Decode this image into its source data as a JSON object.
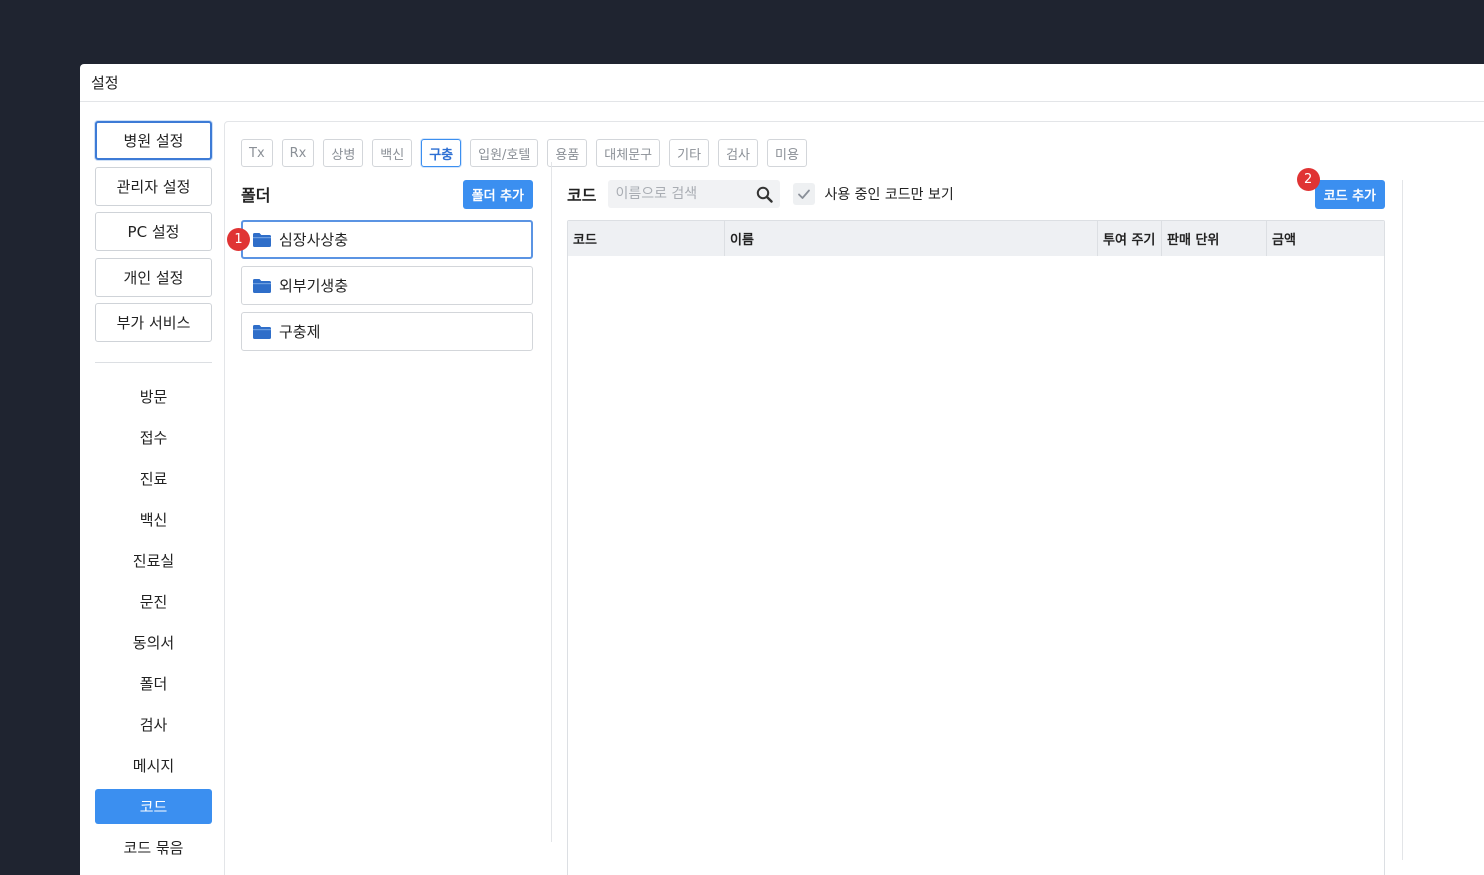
{
  "window": {
    "title": "설정"
  },
  "nav": {
    "buttons": [
      {
        "label": "병원 설정",
        "active": true
      },
      {
        "label": "관리자 설정",
        "active": false
      },
      {
        "label": "PC 설정",
        "active": false
      },
      {
        "label": "개인 설정",
        "active": false
      },
      {
        "label": "부가 서비스",
        "active": false
      }
    ],
    "links": [
      {
        "label": "방문"
      },
      {
        "label": "접수"
      },
      {
        "label": "진료"
      },
      {
        "label": "백신"
      },
      {
        "label": "진료실"
      },
      {
        "label": "문진"
      },
      {
        "label": "동의서"
      },
      {
        "label": "폴더"
      },
      {
        "label": "검사"
      },
      {
        "label": "메시지"
      },
      {
        "label": "코드",
        "active": true
      },
      {
        "label": "코드 묶음"
      }
    ]
  },
  "tabs": [
    {
      "label": "Tx"
    },
    {
      "label": "Rx"
    },
    {
      "label": "상병"
    },
    {
      "label": "백신"
    },
    {
      "label": "구충",
      "active": true
    },
    {
      "label": "입원/호텔"
    },
    {
      "label": "용품"
    },
    {
      "label": "대체문구"
    },
    {
      "label": "기타"
    },
    {
      "label": "검사"
    },
    {
      "label": "미용"
    }
  ],
  "folder_panel": {
    "title": "폴더",
    "add_label": "폴더 추가",
    "items": [
      {
        "label": "심장사상충",
        "selected": true
      },
      {
        "label": "외부기생충"
      },
      {
        "label": "구충제"
      }
    ]
  },
  "code_panel": {
    "title": "코드",
    "search_placeholder": "이름으로 검색",
    "filter_label": "사용 중인 코드만 보기",
    "filter_checked": true,
    "add_label": "코드 추가",
    "columns": [
      "코드",
      "이름",
      "투여 주기",
      "판매 단위",
      "금액"
    ]
  },
  "badges": {
    "one": "1",
    "two": "2"
  },
  "colors": {
    "accent": "#3b8ff0",
    "badge": "#e03434",
    "folder_icon": "#2f6ec9"
  }
}
